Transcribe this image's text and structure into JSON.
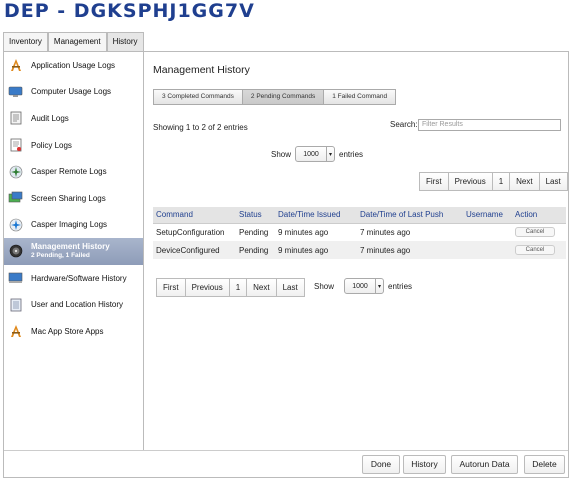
{
  "page": {
    "title": "DEP - DGKSPHJ1GG7V"
  },
  "tabs": [
    {
      "label": "Inventory"
    },
    {
      "label": "Management"
    },
    {
      "label": "History",
      "active": true
    }
  ],
  "sidebar": {
    "items": [
      {
        "label": "Application Usage Logs",
        "icon": "app-usage-icon"
      },
      {
        "label": "Computer Usage Logs",
        "icon": "computer-icon"
      },
      {
        "label": "Audit Logs",
        "icon": "audit-icon"
      },
      {
        "label": "Policy Logs",
        "icon": "policy-icon"
      },
      {
        "label": "Casper Remote Logs",
        "icon": "casper-remote-icon"
      },
      {
        "label": "Screen Sharing Logs",
        "icon": "screen-sharing-icon"
      },
      {
        "label": "Casper Imaging Logs",
        "icon": "casper-imaging-icon"
      },
      {
        "label": "Management History",
        "sublabel": "2 Pending, 1 Failed",
        "icon": "management-history-icon",
        "active": true
      },
      {
        "label": "Hardware/Software History",
        "icon": "hardware-icon"
      },
      {
        "label": "User and Location History",
        "icon": "user-location-icon"
      },
      {
        "label": "Mac App Store Apps",
        "icon": "app-store-icon"
      }
    ]
  },
  "main": {
    "title": "Management History",
    "segments": [
      {
        "label": "3 Completed Commands"
      },
      {
        "label": "2 Pending Commands",
        "active": true
      },
      {
        "label": "1 Failed Command"
      }
    ],
    "showing": "Showing 1 to 2 of 2 entries",
    "search": {
      "label": "Search:",
      "placeholder": "Filter Results"
    },
    "show": {
      "label": "Show",
      "value": "1000",
      "suffix": "entries"
    },
    "pager": [
      "First",
      "Previous",
      "1",
      "Next",
      "Last"
    ],
    "table": {
      "columns": [
        "Command",
        "Status",
        "Date/Time Issued",
        "Date/Time of Last Push",
        "Username",
        "Action"
      ],
      "rows": [
        {
          "command": "SetupConfiguration",
          "status": "Pending",
          "issued": "9 minutes ago",
          "last_push": "7 minutes ago",
          "username": "",
          "action": "Cancel"
        },
        {
          "command": "DeviceConfigured",
          "status": "Pending",
          "issued": "9 minutes ago",
          "last_push": "7 minutes ago",
          "username": "",
          "action": "Cancel"
        }
      ]
    }
  },
  "footer": {
    "done": "Done",
    "history": "History",
    "autorun": "Autorun Data",
    "delete": "Delete"
  },
  "colors": {
    "title": "#1f3f8f",
    "active_sidebar": "#9aa8c2"
  }
}
